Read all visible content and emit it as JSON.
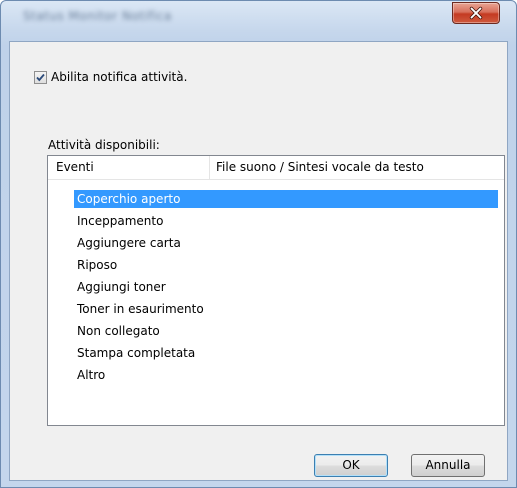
{
  "window": {
    "title": "Status Monitor Notifica"
  },
  "notify_checkbox": {
    "label": "Abilita notifica attività.",
    "checked": true
  },
  "activities": {
    "label": "Attività disponibili:",
    "columns": [
      "Eventi",
      "File suono / Sintesi vocale da testo"
    ],
    "rows": [
      {
        "event": "Coperchio aperto",
        "file": "",
        "selected": true
      },
      {
        "event": "Inceppamento",
        "file": "",
        "selected": false
      },
      {
        "event": "Aggiungere carta",
        "file": "",
        "selected": false
      },
      {
        "event": "Riposo",
        "file": "",
        "selected": false
      },
      {
        "event": "Aggiungi toner",
        "file": "",
        "selected": false
      },
      {
        "event": "Toner in esaurimento",
        "file": "",
        "selected": false
      },
      {
        "event": "Non collegato",
        "file": "",
        "selected": false
      },
      {
        "event": "Stampa completata",
        "file": "",
        "selected": false
      },
      {
        "event": "Altro",
        "file": "",
        "selected": false
      }
    ]
  },
  "buttons": {
    "ok": "OK",
    "cancel": "Annulla"
  },
  "colors": {
    "selection": "#3399ff",
    "close_button": "#c43a22",
    "dialog_background": "#f0f0f0"
  }
}
